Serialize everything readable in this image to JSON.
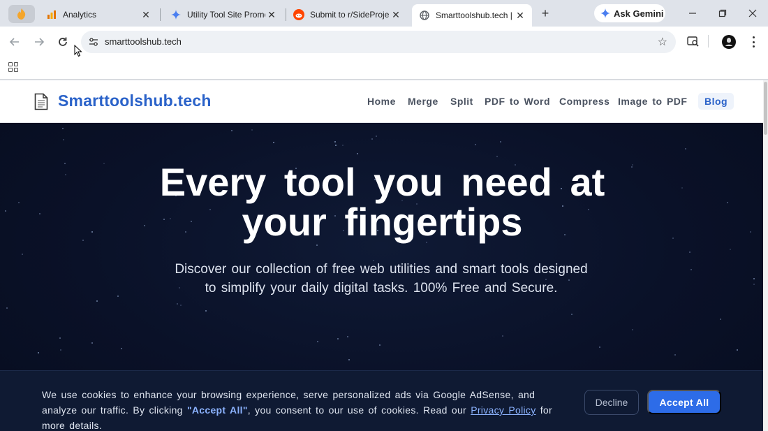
{
  "browser": {
    "tabs": [
      {
        "title": "Analytics",
        "favicon": "analytics-icon",
        "active": false
      },
      {
        "title": "Utility Tool Site Promo",
        "favicon": "gemini-star-icon",
        "active": false
      },
      {
        "title": "Submit to r/SideProje",
        "favicon": "reddit-icon",
        "active": false
      },
      {
        "title": "Smarttoolshub.tech | F",
        "favicon": "globe-icon",
        "active": true
      }
    ],
    "pinned_favicon": "fire-icon",
    "ask_gemini_label": "Ask Gemini",
    "url": "smarttoolshub.tech"
  },
  "site": {
    "brand": "Smarttoolshub.tech",
    "nav": [
      {
        "label": "Home",
        "active": false
      },
      {
        "label": "Merge",
        "active": false
      },
      {
        "label": "Split",
        "active": false
      },
      {
        "label": "PDF to Word",
        "active": false
      },
      {
        "label": "Compress",
        "active": false
      },
      {
        "label": "Image to PDF",
        "active": false
      },
      {
        "label": "Blog",
        "active": true
      }
    ]
  },
  "hero": {
    "title_line1": "Every tool you need at",
    "title_line2": "your fingertips",
    "subtitle": "Discover our collection of free web utilities and smart tools designed to simplify your daily digital tasks. 100% Free and Secure."
  },
  "cookie": {
    "text_before": "We use cookies to enhance your browsing experience, serve personalized ads via Google AdSense, and analyze our traffic. By clicking ",
    "accept_quote": "\"Accept All\"",
    "text_middle": ", you consent to our use of cookies. Read our ",
    "privacy_link": "Privacy Policy",
    "text_after": " for more details.",
    "decline_label": "Decline",
    "accept_label": "Accept All"
  },
  "colors": {
    "brand": "#2a62c9",
    "hero_bg": "#0a1128",
    "accept": "#2d6ce8"
  }
}
